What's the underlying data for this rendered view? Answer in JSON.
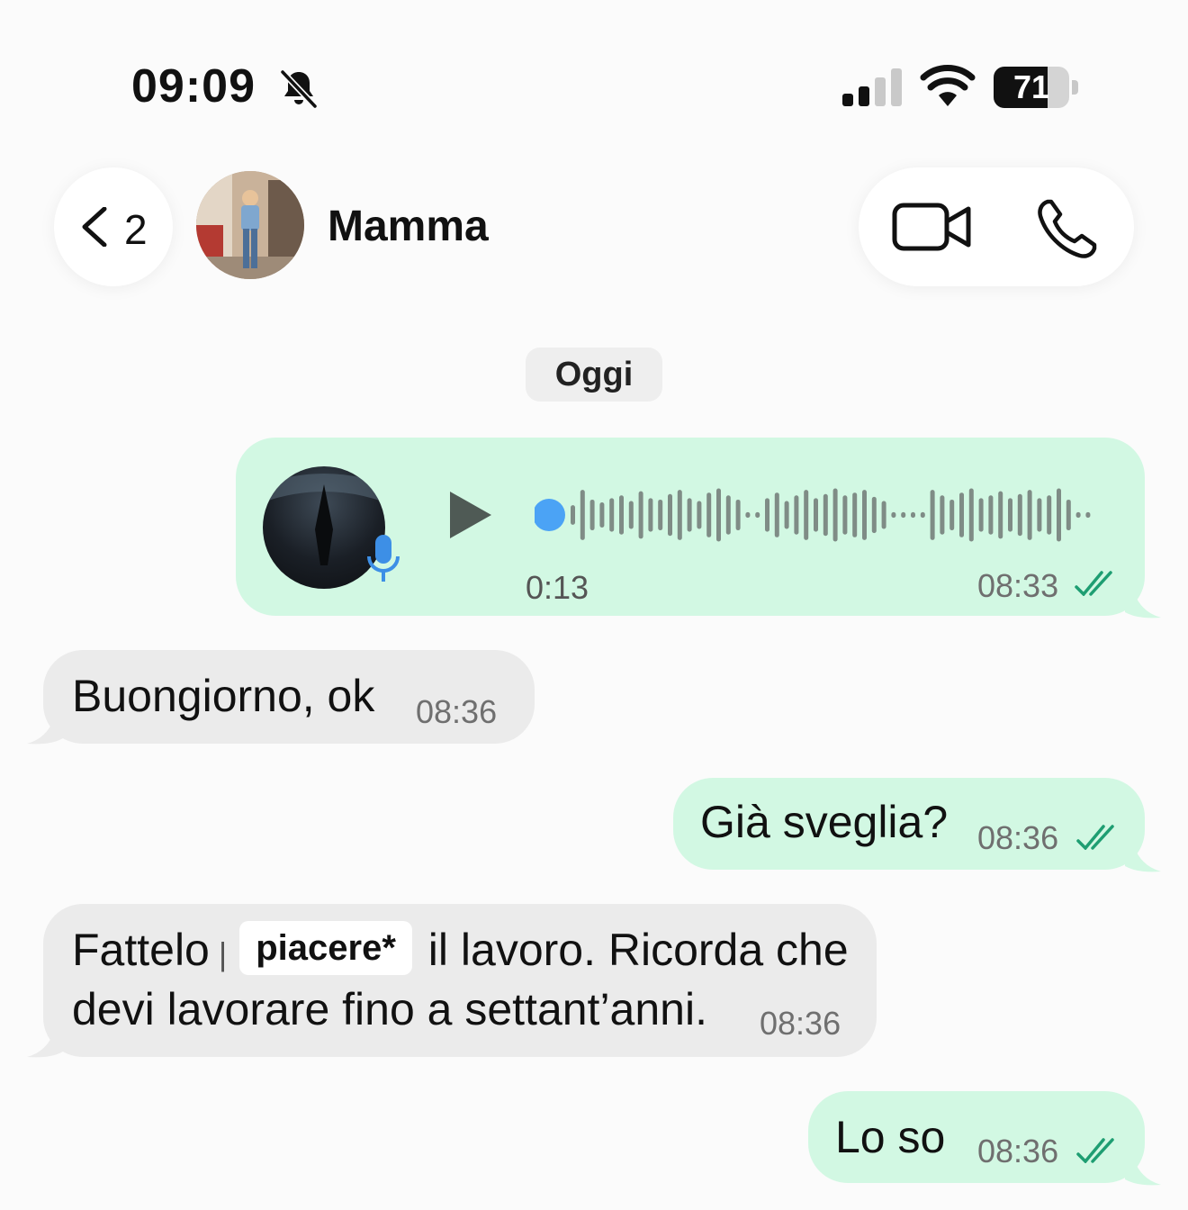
{
  "status_bar": {
    "time": "09:09",
    "silent_icon": "bell-slash-icon",
    "battery_level": "71",
    "battery_fraction": 0.71
  },
  "header": {
    "back_count": "2",
    "contact_name": "Mamma",
    "video_icon": "video-camera-icon",
    "phone_icon": "phone-icon"
  },
  "date_chip": "Oggi",
  "messages": [
    {
      "direction": "outgoing",
      "type": "voice",
      "duration": "0:13",
      "time": "08:33",
      "read": true
    },
    {
      "direction": "incoming",
      "type": "text",
      "text": "Buongiorno, ok",
      "time": "08:36"
    },
    {
      "direction": "outgoing",
      "type": "text",
      "text": "Già sveglia?",
      "time": "08:36",
      "read": true
    },
    {
      "direction": "incoming",
      "type": "text",
      "line1_before": "Fattelo",
      "line1_highlight": "piacere*",
      "line1_after": "il lavoro. Ricorda che",
      "line2": "devi lavorare fino a settant’anni.",
      "time": "08:36"
    },
    {
      "direction": "outgoing",
      "type": "text",
      "text": "Lo so",
      "time": "08:36",
      "read": true
    }
  ],
  "colors": {
    "outgoing_bubble": "#d2f8e3",
    "incoming_bubble": "#ebebeb",
    "read_ticks": "#1e9e72",
    "voice_dot": "#4ba3f5",
    "waveform": "#7f8c86"
  }
}
